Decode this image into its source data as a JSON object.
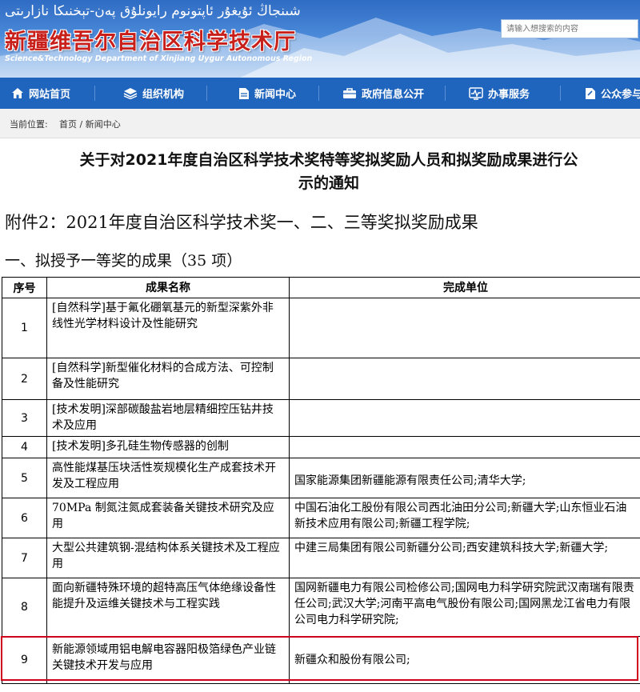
{
  "header": {
    "uyghur_title": "شىنجاڭ ئۇيغۇر ئاپتونوم رايونلۇق پەن-تېخنىكا نازارىتى",
    "title": "新疆维吾尔自治区科学技术厅",
    "english_title": "Science&Technology Department of Xinjiang Uygur Autonomous Region",
    "search_placeholder": "请输入想搜索的内容"
  },
  "nav": [
    {
      "label": "网站首页",
      "icon": "home-icon"
    },
    {
      "label": "组织机构",
      "icon": "layers-icon"
    },
    {
      "label": "新闻中心",
      "icon": "document-icon"
    },
    {
      "label": "政府信息公开",
      "icon": "briefcase-icon"
    },
    {
      "label": "办事服务",
      "icon": "pulse-icon"
    },
    {
      "label": "公众参与",
      "icon": "doc-edit-icon"
    }
  ],
  "breadcrumb": {
    "prefix": "当前位置:",
    "path": "首页 / 新闻中心"
  },
  "article": {
    "title_line1": "关于对2021年度自治区科学技术奖特等奖拟奖励人员和拟奖励成果进行公",
    "title_line2": "示的通知",
    "attachment": "附件2：2021年度自治区科学技术奖一、二、三等奖拟奖励成果",
    "section": "一、拟授予一等奖的成果（35 项）"
  },
  "table": {
    "headers": [
      "序号",
      "成果名称",
      "完成单位"
    ],
    "rows": [
      {
        "no": "1",
        "name": "[自然科学]基于氟化硼氧基元的新型深紫外非线性光学材料设计及性能研究",
        "unit": ""
      },
      {
        "no": "2",
        "name": "[自然科学]新型催化材料的合成方法、可控制备及性能研究",
        "unit": ""
      },
      {
        "no": "3",
        "name": "[技术发明]深部碳酸盐岩地层精细控压钻井技术及应用",
        "unit": ""
      },
      {
        "no": "4",
        "name": "[技术发明]多孔硅生物传感器的创制",
        "unit": ""
      },
      {
        "no": "5",
        "name": "高性能煤基压块活性炭规模化生产成套技术开发及工程应用",
        "unit": "国家能源集团新疆能源有限责任公司;清华大学;"
      },
      {
        "no": "6",
        "name": "70MPa 制氮注氮成套装备关键技术研究及应用",
        "unit": "中国石油化工股份有限公司西北油田分公司;新疆大学;山东恒业石油新技术应用有限公司;新疆工程学院;"
      },
      {
        "no": "7",
        "name": "大型公共建筑钢-混结构体系关键技术及工程应用",
        "unit": "中建三局集团有限公司新疆分公司;西安建筑科技大学;新疆大学;"
      },
      {
        "no": "8",
        "name": "面向新疆特殊环境的超特高压气体绝缘设备性能提升及运维关键技术与工程实践",
        "unit": "国网新疆电力有限公司检修公司;国网电力科学研究院武汉南瑞有限责任公司;武汉大学;河南平高电气股份有限公司;国网黑龙江省电力有限公司电力科学研究院;"
      },
      {
        "no": "9",
        "name": "新能源领域用铝电解电容器阳极箔绿色产业链关键技术开发与应用",
        "unit": "新疆众和股份有限公司;"
      }
    ]
  }
}
